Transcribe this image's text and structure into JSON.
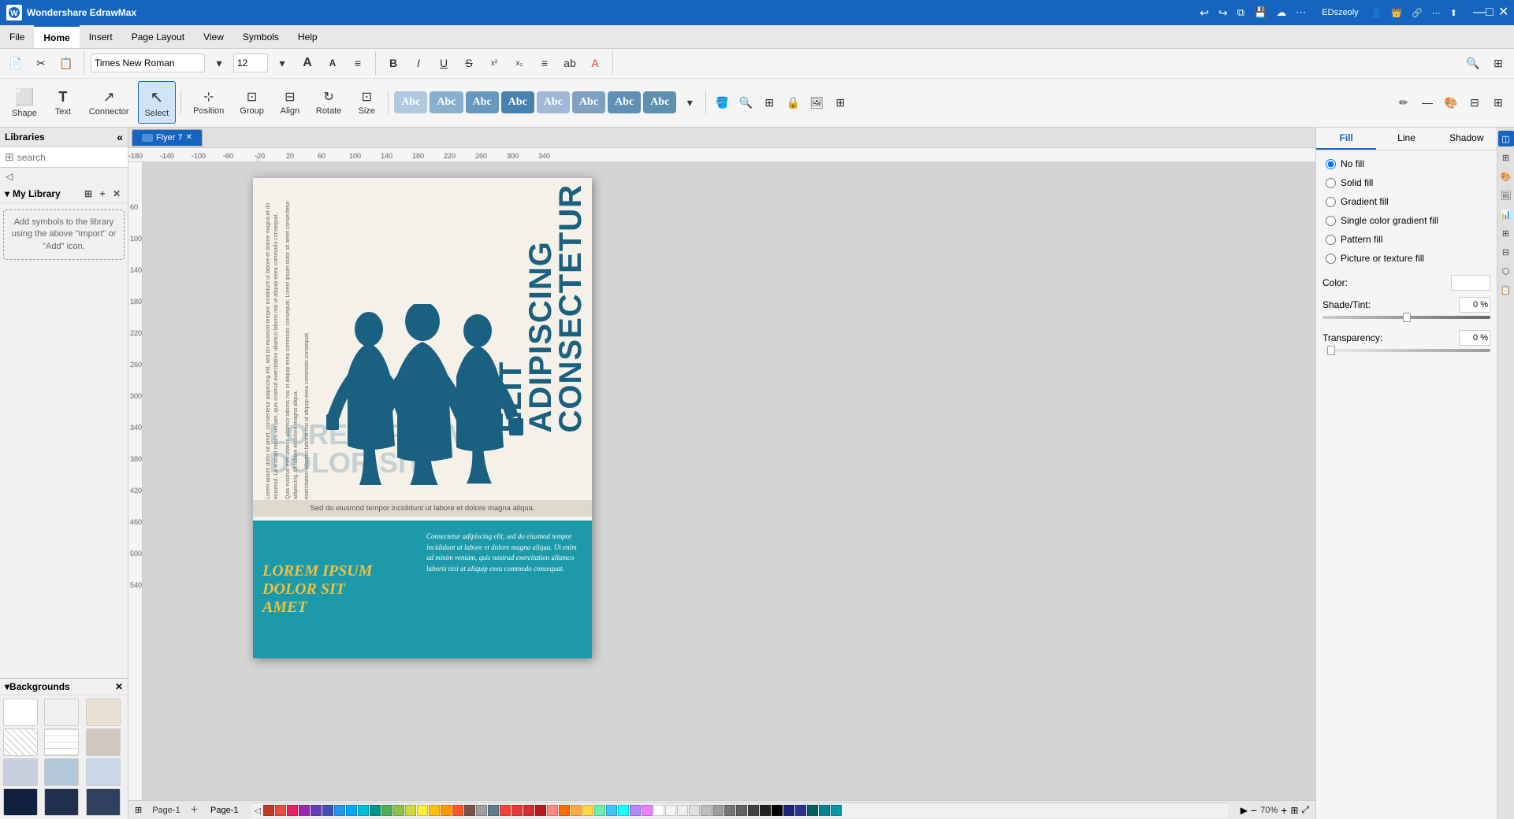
{
  "titleBar": {
    "appName": "Wondershare EdrawMax",
    "filename": "EDszeoly",
    "undoIcon": "↩",
    "redoIcon": "↪",
    "windowControls": [
      "—",
      "□",
      "✕"
    ]
  },
  "menuBar": {
    "items": [
      "File",
      "Home",
      "Insert",
      "Page Layout",
      "View",
      "Symbols",
      "Help"
    ]
  },
  "toolbar": {
    "fontName": "Times New Roman",
    "fontSize": "12",
    "tools": [
      {
        "id": "shape",
        "label": "Shape",
        "icon": "⬜"
      },
      {
        "id": "text",
        "label": "Text",
        "icon": "T"
      },
      {
        "id": "connector",
        "label": "Connector",
        "icon": "⟋"
      },
      {
        "id": "select",
        "label": "Select",
        "icon": "↖"
      }
    ],
    "positionLabel": "Position",
    "groupLabel": "Group",
    "alignLabel": "Align",
    "rotateLabel": "Rotate",
    "sizeLabel": "Size",
    "abcButtons": [
      {
        "color": "#a8c8e8",
        "label": "Abc"
      },
      {
        "color": "#8ab4d8",
        "label": "Abc"
      },
      {
        "color": "#7aa0c8",
        "label": "Abc"
      },
      {
        "color": "#6890b8",
        "label": "Abc"
      },
      {
        "color": "#a8c8e8",
        "label": "Abc"
      },
      {
        "color": "#88b4d4",
        "label": "Abc"
      },
      {
        "color": "#78a4c4",
        "label": "Abc"
      },
      {
        "color": "#68afc0",
        "label": "Abc"
      }
    ]
  },
  "sidebar": {
    "title": "Libraries",
    "searchPlaceholder": "search",
    "myLibraryTitle": "My Library",
    "addSymbolsText": "Add symbols to the library using the above \"Import\" or \"Add\" icon.",
    "backgroundsTitle": "Backgrounds",
    "backgrounds": [
      {
        "bg": "#ffffff"
      },
      {
        "bg": "#f0f0f0"
      },
      {
        "bg": "#e8e0d0"
      },
      {
        "bg": "repeating-linear-gradient(45deg, #ccc 0, #ccc 1px, #fff 0, #fff 50%)"
      },
      {
        "bg": "repeating-linear-gradient(0deg, #ddd 0, #ddd 1px, #fff 0, #fff 8px)"
      },
      {
        "bg": "#d0c8c0"
      },
      {
        "bg": "#c0c0c0"
      },
      {
        "bg": "#b0c8d8"
      },
      {
        "bg": "#c8d8e8"
      },
      {
        "bg": "#102040"
      },
      {
        "bg": "#203050"
      },
      {
        "bg": "#304060"
      }
    ]
  },
  "canvas": {
    "pageTab": "Flyer 7",
    "pageTabClose": "✕",
    "pageNameBottom": "Page-1",
    "addPageIcon": "+",
    "zoomLevel": "70%",
    "rulerUnit": ""
  },
  "flyer": {
    "mainTitle": "CONSECTETUR\nADIPISCING\nELIT",
    "overlayText": "LOREM IPSUM\nDOLOR SIT",
    "subtitleBar": "Sed do eiusmod tempor incididunt ut labore et dolore magna aliqua.",
    "loremTitle": "LOREM IPSUM\nDOLOR SIT\nAMET",
    "loremBody": "Consectetur adipiscing elit, sed do eiusmod tempor incididunt ut labore et dolore magna aliqua. Ut enim ad minim veniam, quis nostrud exercitation ullamco laboris nisi ut aliquip exea commodo consequat.",
    "sideTextLong": "Lorem ipsum dolor sit amet, consectetur adipiscing elit, sed do eiusmod tempor incididunt ut labore et dolore magna et do eiusmod tempor incididunt ut labore. La enmad minim veniam, quis nostrud exercitation ullamco laboris nisi ut aliquip exea commodo consequat."
  },
  "rightPanel": {
    "fillTab": "Fill",
    "lineTab": "Line",
    "shadowTab": "Shadow",
    "fillOptions": [
      {
        "id": "no-fill",
        "label": "No fill",
        "selected": true
      },
      {
        "id": "solid-fill",
        "label": "Solid fill"
      },
      {
        "id": "gradient-fill",
        "label": "Gradient fill"
      },
      {
        "id": "single-color-gradient",
        "label": "Single color gradient fill"
      },
      {
        "id": "pattern-fill",
        "label": "Pattern fill"
      },
      {
        "id": "picture-texture",
        "label": "Picture or texture fill"
      }
    ],
    "colorLabel": "Color:",
    "shadeTintLabel": "Shade/Tint:",
    "transparencyLabel": "Transparency:",
    "shadePercent": "0 %",
    "transparencyPercent": "0 %"
  },
  "colorPalette": {
    "colors": [
      "#c0392b",
      "#e74c3c",
      "#e91e63",
      "#9c27b0",
      "#673ab7",
      "#3f51b5",
      "#2196f3",
      "#03a9f4",
      "#00bcd4",
      "#009688",
      "#4caf50",
      "#8bc34a",
      "#cddc39",
      "#ffeb3b",
      "#ffc107",
      "#ff9800",
      "#ff5722",
      "#795548",
      "#9e9e9e",
      "#607d8b",
      "#f44336",
      "#e53935",
      "#d32f2f",
      "#c62828",
      "#ff8a80",
      "#ff6d00",
      "#ffab40",
      "#ffd740",
      "#69f0ae",
      "#40c4ff",
      "#18ffff",
      "#b388ff",
      "#ea80fc",
      "#ffffff",
      "#f5f5f5",
      "#eeeeee",
      "#e0e0e0",
      "#bdbdbd",
      "#9e9e9e",
      "#757575",
      "#616161",
      "#424242",
      "#212121",
      "#000000",
      "#1a237e",
      "#283593",
      "#303f9f",
      "#3949ab",
      "#3f51b5",
      "#5c6bc0",
      "#7986cb",
      "#9fa8da",
      "#c5cae9",
      "#e8eaf6",
      "#006064",
      "#00838f",
      "#0097a7",
      "#00acc1",
      "#00bcd4",
      "#26c6da",
      "#4dd0e1",
      "#80deea"
    ]
  },
  "icons": {
    "search": "🔍",
    "chevronLeft": "‹",
    "chevronRight": "›",
    "chevronDown": "▾",
    "chevronUp": "▴",
    "minus": "−",
    "plus": "+",
    "close": "✕",
    "settings": "⚙",
    "layers": "◫",
    "page": "📄",
    "bold": "B",
    "italic": "I",
    "underline": "U",
    "strikethrough": "S",
    "superscript": "x²",
    "subscript": "x₂",
    "list": "≡",
    "alignLeft": "≡",
    "more": "▸"
  }
}
